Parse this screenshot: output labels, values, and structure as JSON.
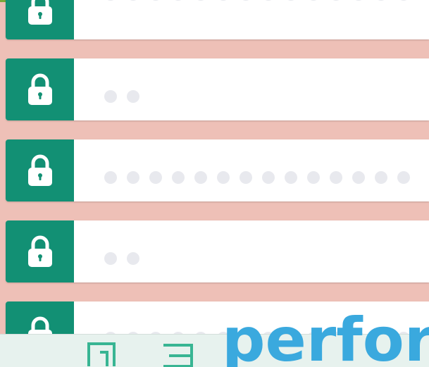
{
  "colors": {
    "background": "#eec0b7",
    "top_accent": "#78a83a",
    "lock_bg": "#129074",
    "lock_icon": "#ffffff",
    "dot": "#e8e9ee",
    "field_bg": "#ffffff",
    "bottom_band": "#e7f2ee",
    "overlay_text": "#3aa9de",
    "glyph_stroke": "#38b593"
  },
  "rows": [
    {
      "icon": "lock-icon",
      "dot_count": 14
    },
    {
      "icon": "lock-icon",
      "dot_count": 2
    },
    {
      "icon": "lock-icon",
      "dot_count": 14
    },
    {
      "icon": "lock-icon",
      "dot_count": 2
    },
    {
      "icon": "lock-icon",
      "dot_count": 14
    }
  ],
  "overlay": {
    "text": "perform"
  }
}
